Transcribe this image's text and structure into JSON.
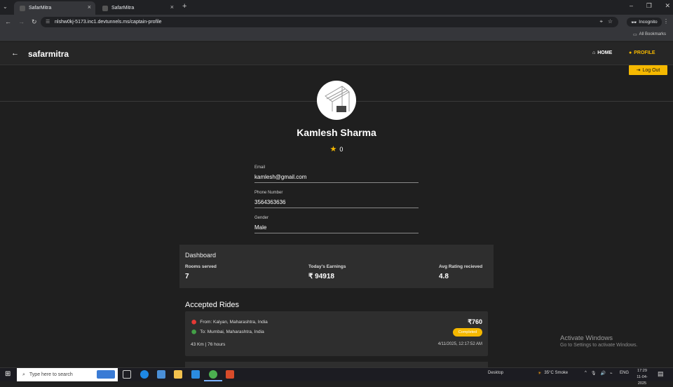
{
  "browser": {
    "tabs": [
      {
        "label": "SafarMitra"
      },
      {
        "label": "SafarMitra"
      }
    ],
    "new_tab": "+",
    "url": "nlshw0kj-5173.inc1.devtunnels.ms/captain-profile",
    "incognito": "Incognito",
    "all_bookmarks": "All Bookmarks"
  },
  "app": {
    "brand": "safarmitra",
    "nav": {
      "home": "HOME",
      "profile": "PROFILE"
    },
    "logout": "Log Out"
  },
  "profile": {
    "name": "Kamlesh Sharma",
    "rating": "0",
    "fields": [
      {
        "label": "Email",
        "value": "kamlesh@gmail.com"
      },
      {
        "label": "Phone Number",
        "value": "3564363636"
      },
      {
        "label": "Gender",
        "value": "Male"
      }
    ]
  },
  "dashboard": {
    "title": "Dashboard",
    "stats": [
      {
        "label": "Rooms served",
        "value": "7"
      },
      {
        "label": "Today's Earnings",
        "value": "₹ 94918"
      },
      {
        "label": "Avg Rating recieved",
        "value": "4.8"
      }
    ]
  },
  "rides": {
    "title": "Accepted Rides",
    "items": [
      {
        "from": "From: Kalyan, Maharashtra, India",
        "to": "To: Mumbai, Maharashtra, India",
        "price": "₹760",
        "status": "Completed",
        "meta": "43 Km | 76 hours",
        "datetime": "4/11/2025, 12:17:52 AM"
      }
    ]
  },
  "windows": {
    "watermark_title": "Activate Windows",
    "watermark_sub": "Go to Settings to activate Windows.",
    "search_placeholder": "Type here to search",
    "desktop": "Desktop",
    "weather": "35°C  Smoke",
    "lang": "ENG",
    "time": "17:29",
    "date": "11-04-2025"
  },
  "colors": {
    "accent": "#f5b800",
    "background": "#1f1f1f",
    "card": "#2e2e2e",
    "pin_from": "#e53935",
    "pin_to": "#43a047"
  }
}
